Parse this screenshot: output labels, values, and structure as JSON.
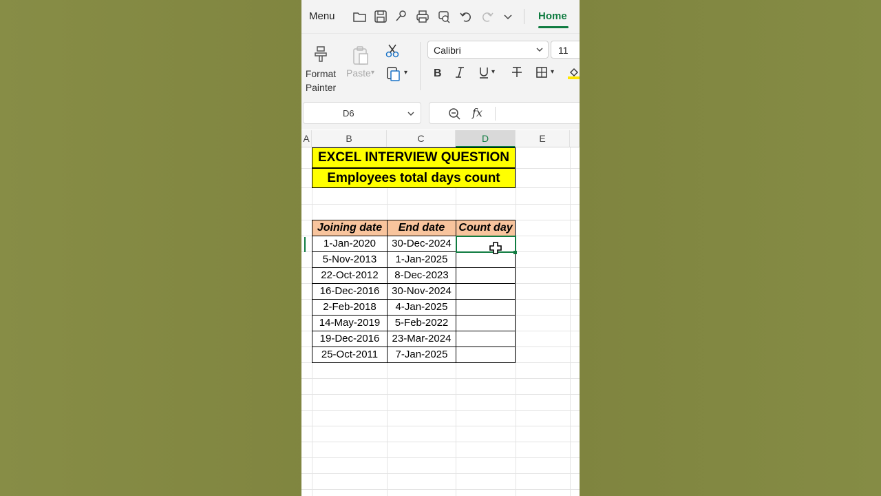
{
  "toolbar": {
    "menu_label": "Menu",
    "home_tab": "Home"
  },
  "ribbon": {
    "format_painter_label": "Format\nPainter",
    "paste_label": "Paste",
    "font_name": "Calibri",
    "font_size": "11"
  },
  "formula_bar": {
    "name_box": "D6",
    "fx_label": "fx",
    "formula_value": ""
  },
  "columns": [
    "A",
    "B",
    "C",
    "D",
    "E"
  ],
  "sheet": {
    "title": "EXCEL INTERVIEW QUESTION",
    "subtitle": "Employees total days count",
    "headers": [
      "Joining date",
      "End date",
      "Count day"
    ],
    "rows": [
      [
        "1-Jan-2020",
        "30-Dec-2024",
        ""
      ],
      [
        "5-Nov-2013",
        "1-Jan-2025",
        ""
      ],
      [
        "22-Oct-2012",
        "8-Dec-2023",
        ""
      ],
      [
        "16-Dec-2016",
        "30-Nov-2024",
        ""
      ],
      [
        "2-Feb-2018",
        "4-Jan-2025",
        ""
      ],
      [
        "14-May-2019",
        "5-Feb-2022",
        ""
      ],
      [
        "19-Dec-2016",
        "23-Mar-2024",
        ""
      ],
      [
        "25-Oct-2011",
        "7-Jan-2025",
        ""
      ]
    ]
  },
  "colors": {
    "accent": "#107c41",
    "title_fill": "#ffff00",
    "header_fill": "#f8c49d",
    "backdrop": "#828940"
  }
}
